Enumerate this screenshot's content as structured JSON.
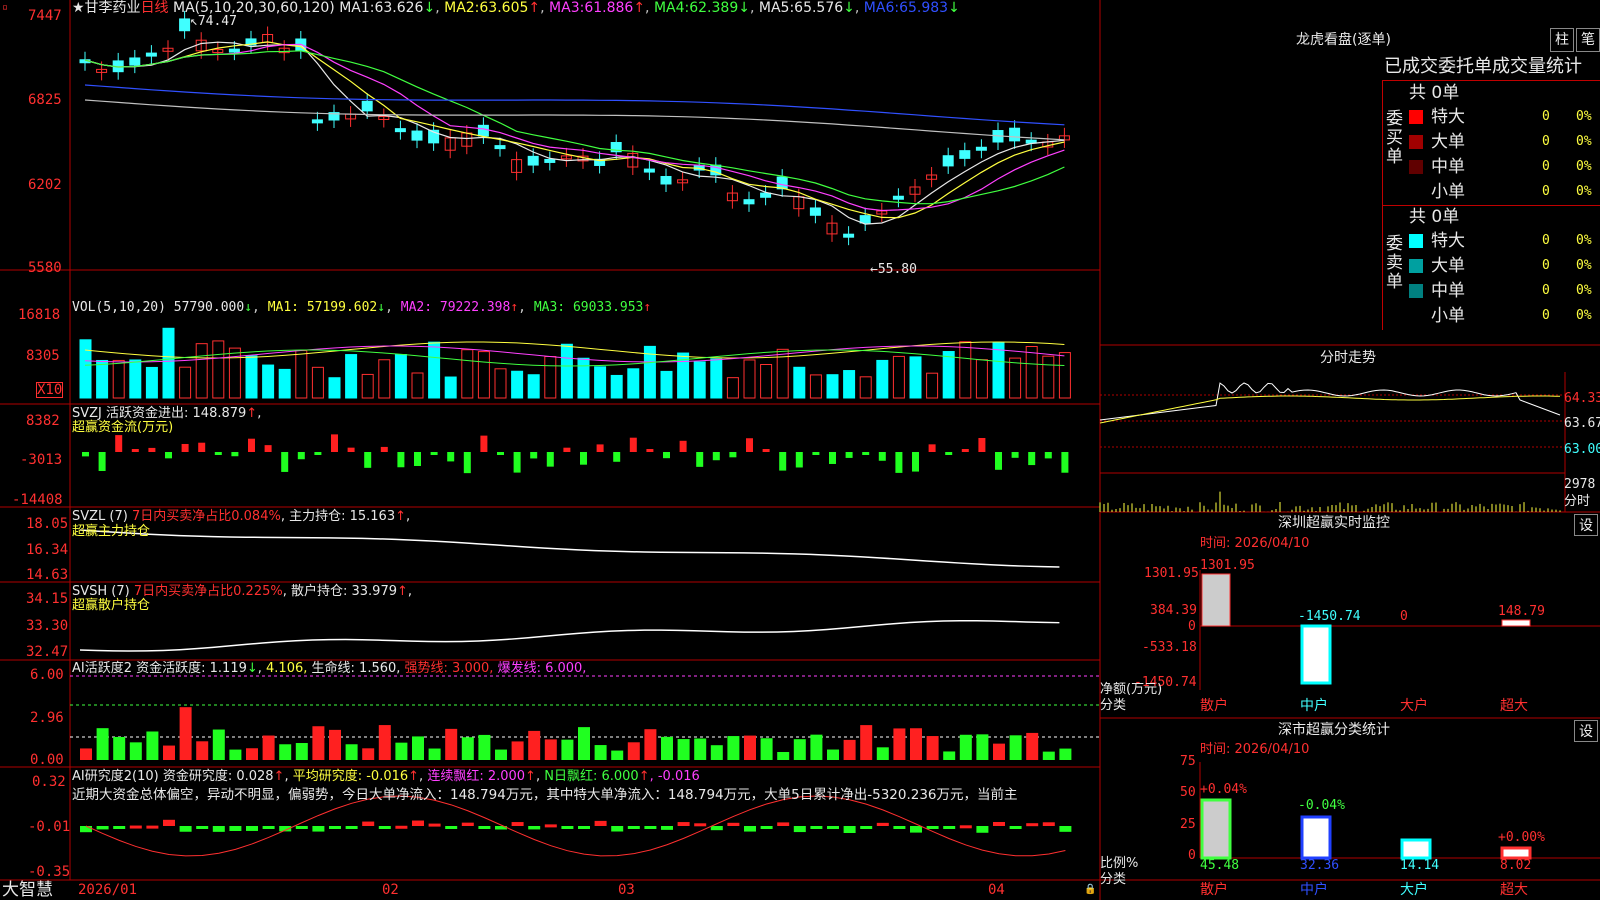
{
  "header": {
    "stock": "★甘李药业",
    "period": "日线",
    "ma_label": "MA(5,10,20,30,60,120)",
    "ma": [
      {
        "l": "MA1:",
        "v": "63.626",
        "a": "↓"
      },
      {
        "l": "MA2:",
        "v": "63.605",
        "a": "↑"
      },
      {
        "l": "MA3:",
        "v": "61.886",
        "a": "↑"
      },
      {
        "l": "MA4:",
        "v": "62.389",
        "a": "↓"
      },
      {
        "l": "MA5:",
        "v": "65.576",
        "a": "↓"
      },
      {
        "l": "MA6:",
        "v": "65.983",
        "a": "↓"
      }
    ],
    "hi": "74.47",
    "lo": "55.80"
  },
  "axes": {
    "price": [
      "7447",
      "6825",
      "6202",
      "5580"
    ],
    "vol": [
      "16818",
      "8305"
    ],
    "volx": "X10",
    "svzj": [
      "8382",
      "-3013",
      "-14408"
    ],
    "svzl": [
      "18.05",
      "16.34",
      "14.63"
    ],
    "svsh": [
      "34.15",
      "33.30",
      "32.47"
    ],
    "ai": [
      "6.00",
      "2.96",
      "0.00"
    ],
    "air": [
      "0.32",
      "-0.01",
      "-0.35"
    ]
  },
  "vol": {
    "label": "VOL(5,10,20)",
    "v": "57790.000",
    "ma1": "MA1: 57199.602",
    "ma2": "MA2: 79222.398",
    "ma3": "MA3: 69033.953"
  },
  "svzj": {
    "label": "SVZJ  活跃资金进出: 148.879",
    "sub": "超赢资金流(万元)"
  },
  "svzl": {
    "label": "SVZL (7)",
    "t1": "7日内买卖净占比0.084%",
    "t2": "主力持仓: 15.163",
    "sub": "超赢主力持仓"
  },
  "svsh": {
    "label": "SVSH (7)",
    "t1": "7日内买卖净占比0.225%",
    "t2": "散户持仓: 33.979",
    "sub": "超赢散户持仓"
  },
  "ai": {
    "label": "AI活跃度2 资金活跃度: 1.119",
    "v2": "4.106,",
    "life": "生命线: 1.560,",
    "strong": "强势线: 3.000,",
    "burst": "爆发线: 6.000,"
  },
  "air": {
    "label": "AI研究度2(10) 资金研究度: 0.028",
    "avg": "平均研究度: -0.016",
    "red": "连续飘红: 2.000",
    "nred": "N日飘红: 6.000",
    "last": ", -0.016",
    "desc": "近期大资金总体偏空，异动不明显，偏弱势，今日大单净流入：148.794万元，其中特大单净流入：148.794万元，大单5日累计净出-5320.236万元，当前主"
  },
  "dates": [
    "2026/01",
    "02",
    "03",
    "04"
  ],
  "brand": "大智慧",
  "right": {
    "lhb": "龙虎看盘(逐单)",
    "tab1": "柱",
    "tab2": "笔",
    "head": "已成交委托单成交量统计",
    "buy": {
      "side": "委买单",
      "count": "共 0单",
      "rows": [
        {
          "n": "特大",
          "v": "0",
          "p": "0%",
          "c": "#ff0000"
        },
        {
          "n": "大单",
          "v": "0",
          "p": "0%",
          "c": "#a00000"
        },
        {
          "n": "中单",
          "v": "0",
          "p": "0%",
          "c": "#600000"
        },
        {
          "n": "小单",
          "v": "0",
          "p": "0%",
          "c": ""
        }
      ]
    },
    "sell": {
      "side": "委卖单",
      "count": "共 0单",
      "rows": [
        {
          "n": "特大",
          "v": "0",
          "p": "0%",
          "c": "#00ffff"
        },
        {
          "n": "大单",
          "v": "0",
          "p": "0%",
          "c": "#00a0a0"
        },
        {
          "n": "中单",
          "v": "0",
          "p": "0%",
          "c": "#008080"
        },
        {
          "n": "小单",
          "v": "0",
          "p": "0%",
          "c": ""
        }
      ]
    },
    "ts": {
      "title": "分时走势",
      "p1": "64.33",
      "p2": "63.67",
      "p3": "63.00",
      "vol": "2978",
      "unit": "分时"
    },
    "mon": {
      "title": "深圳超赢实时监控",
      "set": "设",
      "time": "时间: 2026/04/10",
      "ylab": [
        "1301.95",
        "384.39",
        "0",
        "-533.18",
        "-1450.74"
      ],
      "unit": "净额(万元)",
      "cat": "分类",
      "labels": [
        "1301.95",
        "-1450.74",
        "0",
        "148.79"
      ],
      "cats": [
        "散户",
        "中户",
        "大户",
        "超大"
      ]
    },
    "cls": {
      "title": "深市超赢分类统计",
      "set": "设",
      "time": "时间: 2026/04/10",
      "ylab": [
        "75",
        "50",
        "25",
        "0"
      ],
      "unit": "比例%",
      "cat": "分类",
      "tops": [
        "+0.04%",
        "-0.04%",
        "",
        "+0.00%"
      ],
      "vals": [
        "45.48",
        "32.36",
        "14.14",
        "8.02"
      ],
      "cats": [
        "散户",
        "中户",
        "大户",
        "超大"
      ]
    }
  }
}
